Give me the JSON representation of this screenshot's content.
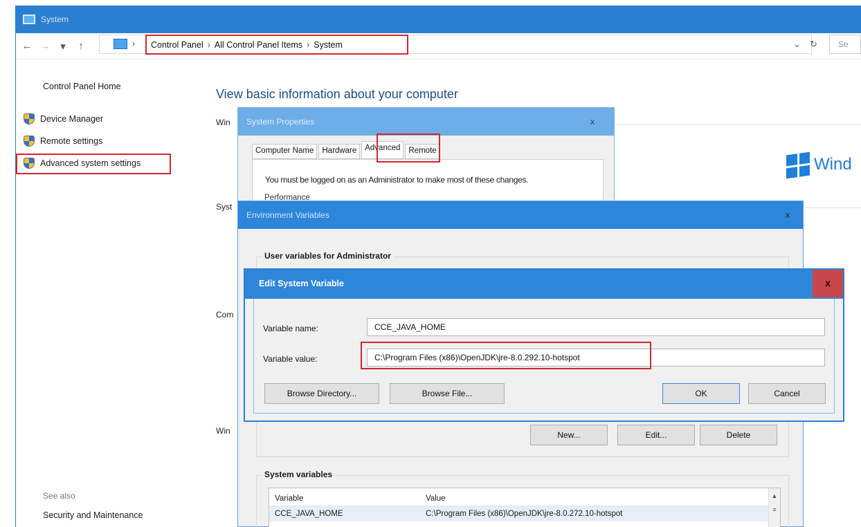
{
  "system_window": {
    "title": "System",
    "address": {
      "back": "←",
      "forward": "→",
      "recent": "▾",
      "up": "↑",
      "separator": "›",
      "crumbs": [
        "Control Panel",
        "All Control Panel Items",
        "System"
      ],
      "dropdown": "⌄",
      "refresh": "↻",
      "search_placeholder": "Se"
    },
    "left_pane": {
      "home": "Control Panel Home",
      "links": [
        "Device Manager",
        "Remote settings",
        "Advanced system settings"
      ],
      "see_also": "See also",
      "security": "Security and Maintenance"
    },
    "main": {
      "heading": "View basic information about your computer",
      "fragments": [
        "Win",
        "Syst",
        "Com",
        "Win"
      ],
      "windows_brand": "Wind"
    }
  },
  "system_properties": {
    "title": "System Properties",
    "close": "x",
    "tabs": [
      "Computer Name",
      "Hardware",
      "Advanced",
      "Remote"
    ],
    "active_tab": "Advanced",
    "notice": "You must be logged on as an Administrator to make most of these changes.",
    "performance_fragment": "Performance"
  },
  "environment_variables": {
    "title": "Environment Variables",
    "close": "x",
    "user_group": "User variables for Administrator",
    "user_buttons": {
      "new": "New...",
      "edit": "Edit...",
      "delete": "Delete"
    },
    "system_group": "System variables",
    "table": {
      "headers": [
        "Variable",
        "Value"
      ],
      "rows": [
        {
          "variable": "CCE_JAVA_HOME",
          "value": "C:\\Program Files (x86)\\OpenJDK\\jre-8.0.272.10-hotspot"
        }
      ],
      "scroll_up": "▲",
      "scroll_thumb": "≡"
    }
  },
  "edit_dialog": {
    "title": "Edit System Variable",
    "close": "x",
    "name_label": "Variable name:",
    "name_value": "CCE_JAVA_HOME",
    "value_label": "Variable value:",
    "value_value": "C:\\Program Files (x86)\\OpenJDK\\jre-8.0.292.10-hotspot",
    "buttons": {
      "browse_directory": "Browse Directory...",
      "browse_file": "Browse File...",
      "ok": "OK",
      "cancel": "Cancel"
    }
  },
  "colors": {
    "accent": "#2b7fd0",
    "highlight": "#d3262d",
    "close_red": "#c7474a"
  }
}
